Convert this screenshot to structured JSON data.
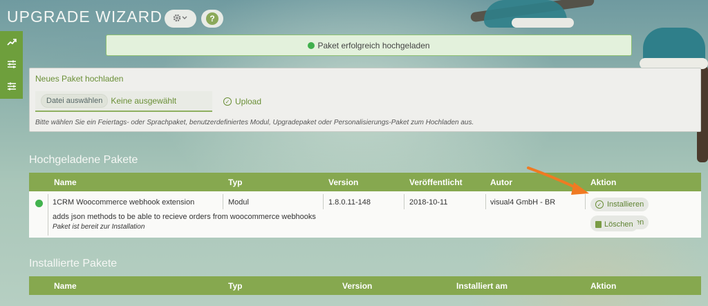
{
  "header": {
    "title": "UPGRADE WIZARD",
    "gear_label": "⚙ ⌄",
    "help_label": "?"
  },
  "sidebar": {
    "items": [
      {
        "icon": "trend-icon",
        "glyph": "↗"
      },
      {
        "icon": "sliders-icon",
        "glyph": "≡"
      },
      {
        "icon": "sliders-icon",
        "glyph": "≡"
      }
    ]
  },
  "alert": {
    "message": "Paket erfolgreich hochgeladen",
    "color": "#40b04d"
  },
  "upload": {
    "title": "Neues Paket hochladen",
    "file_button": "Datei auswählen",
    "file_status": "Keine ausgewählt",
    "upload_label": "Upload",
    "hint": "Bitte wählen Sie ein Feiertags- oder Sprachpaket, benutzerdefiniertes Modul, Upgradepaket oder Personalisierungs-Paket zum Hochladen aus."
  },
  "uploaded": {
    "section_title": "Hochgeladene Pakete",
    "columns": [
      "Name",
      "Typ",
      "Version",
      "Veröffentlicht",
      "Autor",
      "Aktion"
    ],
    "rows": [
      {
        "name": "1CRM Woocommerce webhook extension",
        "type": "Modul",
        "version": "1.8.0.11-148",
        "published": "2018-10-11",
        "author": "visual4 GmbH - BR",
        "description": "adds json methods to be able to recieve orders from woocommerce webhooks",
        "status_text": "Paket ist bereit zur Installation",
        "install_label": "Installieren",
        "delete_label": "Löschen"
      }
    ]
  },
  "installed": {
    "section_title": "Installierte Pakete",
    "columns": [
      "Name",
      "Typ",
      "Version",
      "Installiert am",
      "Aktion"
    ]
  },
  "colors": {
    "accent_green": "#86a84f",
    "sidebar_green": "#6e9f3c",
    "arrow_orange": "#f07a22"
  }
}
